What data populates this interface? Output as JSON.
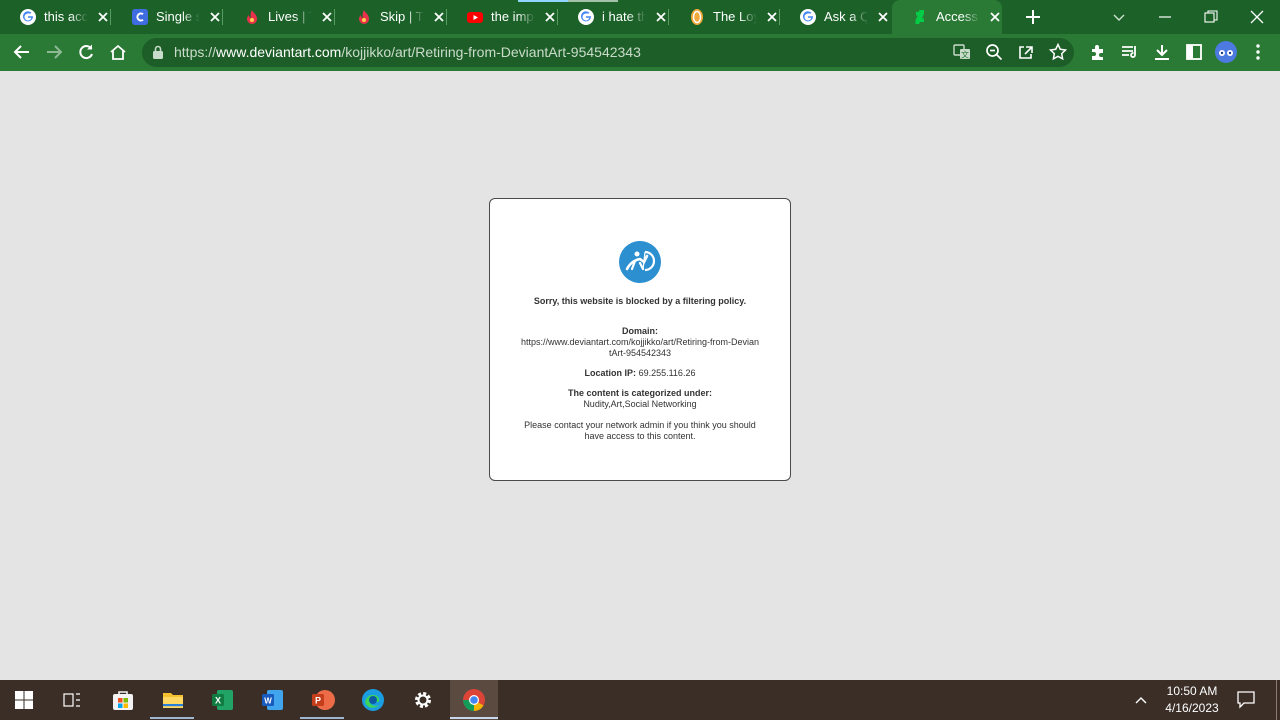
{
  "browser": {
    "tabs": [
      {
        "title": "this account",
        "favicon": "google-icon",
        "active": false
      },
      {
        "title": "Single sign-on",
        "favicon": "c-logo-icon",
        "active": false
      },
      {
        "title": "Lives | The",
        "favicon": "flame-icon",
        "active": false
      },
      {
        "title": "Skip | The",
        "favicon": "flame-icon",
        "active": false
      },
      {
        "title": "the impossible",
        "favicon": "youtube-icon",
        "active": false
      },
      {
        "title": "i hate the",
        "favicon": "google-icon",
        "active": false
      },
      {
        "title": "The Loyal",
        "favicon": "coin-icon",
        "active": false
      },
      {
        "title": "Ask a Question",
        "favicon": "google-icon",
        "active": false
      },
      {
        "title": "Access Denied",
        "favicon": "deviantart-icon",
        "active": true
      }
    ],
    "url": {
      "scheme": "https://",
      "host": "www.deviantart.com",
      "path": "/kojjikko/art/Retiring-from-DeviantArt-954542343"
    },
    "colors": {
      "frame": "#1b6128",
      "toolbar": "#2a7a36",
      "omnibox": "#1d5d27",
      "accent": "#4d7ae0"
    }
  },
  "block_page": {
    "heading": "Sorry, this website is blocked by a filtering policy.",
    "domain_label": "Domain:",
    "domain_value": "https://www.deviantart.com/kojjikko/art/Retiring-from-DeviantArt-954542343",
    "ip_label": "Location IP:",
    "ip_value": "69.255.116.26",
    "category_label": "The content is categorized under:",
    "category_value": "Nudity,Art,Social Networking",
    "contact_text": "Please contact your network admin if you think you should have access to this content.",
    "logo_color": "#2b8fd0"
  },
  "taskbar": {
    "time": "10:50 AM",
    "date": "4/16/2023",
    "icons": [
      "windows-start-icon",
      "task-view-icon",
      "store-icon",
      "file-explorer-icon",
      "excel-icon",
      "word-icon",
      "powerpoint-icon",
      "edge-icon",
      "settings-icon",
      "chrome-icon"
    ],
    "color": "#3a2e27"
  }
}
